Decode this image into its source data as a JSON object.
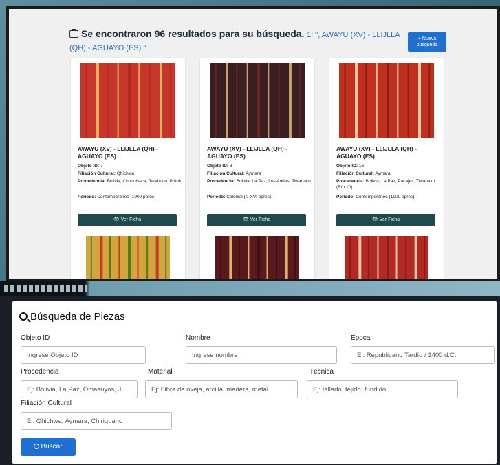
{
  "results": {
    "header_count": "Se encontraron 96 resultados para su búsqueda.",
    "header_query": "1: \", AWAYU (XV) - LLIJLLA (QH) - AGUAYO (ES).\"",
    "new_search_label": "+ Nueva búsqueda",
    "cards": [
      {
        "title": "AWAYU (XV) - LLIJLLA (QH) - AGUAYO (ES)",
        "object_id_label": "Objeto ID:",
        "object_id": "7",
        "cultural_label": "Filiación Cultural:",
        "cultural": "Qhichwa",
        "origin_label": "Procedencia:",
        "origin": "Bolivia, Chuquisaca, Tarabuco, Potolo",
        "period_label": "Periodo:",
        "period": "Contemporáneo (1900 ppres)",
        "view_label": "Ver Ficha",
        "colors": [
          "#c7362a",
          "#b02a22",
          "#e2b25a"
        ]
      },
      {
        "title": "AWAYU (XV) - LLIJLLA (QH) - AGUAYO (ES)",
        "object_id_label": "Objeto ID:",
        "object_id": "8",
        "cultural_label": "Filiación Cultural:",
        "cultural": "Aymara",
        "origin_label": "Procedencia:",
        "origin": "Bolivia, La Paz, Los Andes, Tiwanaku",
        "period_label": "Periodo:",
        "period": "Colonial (s. XVI ppres)",
        "view_label": "Ver Ficha",
        "colors": [
          "#3a1f22",
          "#6b2320",
          "#c9a06a"
        ]
      },
      {
        "title": "AWAYU (XV) - LLIJLLA (QH) - AGUAYO (ES)",
        "object_id_label": "Objeto ID:",
        "object_id": "16",
        "cultural_label": "Filiación Cultural:",
        "cultural": "Aymara",
        "origin_label": "Procedencia:",
        "origin": "Bolivia, La Paz, Pacajes, Tiwanaku (Río 10)",
        "period_label": "Periodo:",
        "period": "Contemporáneo (1900 ppres)",
        "view_label": "Ver Ficha",
        "colors": [
          "#c0301f",
          "#8e1e14",
          "#f3c9a0"
        ]
      }
    ],
    "second_row_colors": [
      [
        "#d2a63b",
        "#4f7a2a",
        "#c23a2a"
      ],
      [
        "#5a1a1d",
        "#3a1213",
        "#d9b46a"
      ],
      [
        "#b32a25",
        "#8c1c18",
        "#e6c7a8"
      ]
    ]
  },
  "search": {
    "title": "Búsqueda de Piezas",
    "fields": {
      "object_id": {
        "label": "Objeto ID",
        "placeholder": "Ingrese Objeto ID"
      },
      "name": {
        "label": "Nombre",
        "placeholder": "Ingrese nombre"
      },
      "epoch": {
        "label": "Época",
        "placeholder": "Ej: Republicano Tardío / 1400 d.C."
      },
      "origin": {
        "label": "Procedencia",
        "placeholder": "Ej: Bolivia, La Paz, Omasuyos, J"
      },
      "material": {
        "label": "Material",
        "placeholder": "Ej: Fibra de oveja, arcilla, madera, metal"
      },
      "technique": {
        "label": "Técnica",
        "placeholder": "Ej: tallado, tejido, fundido"
      },
      "cultural": {
        "label": "Filiación Cultural",
        "placeholder": "Ej: Qhichwa, Aymara, Chiriguano"
      }
    },
    "button_label": "Buscar"
  }
}
